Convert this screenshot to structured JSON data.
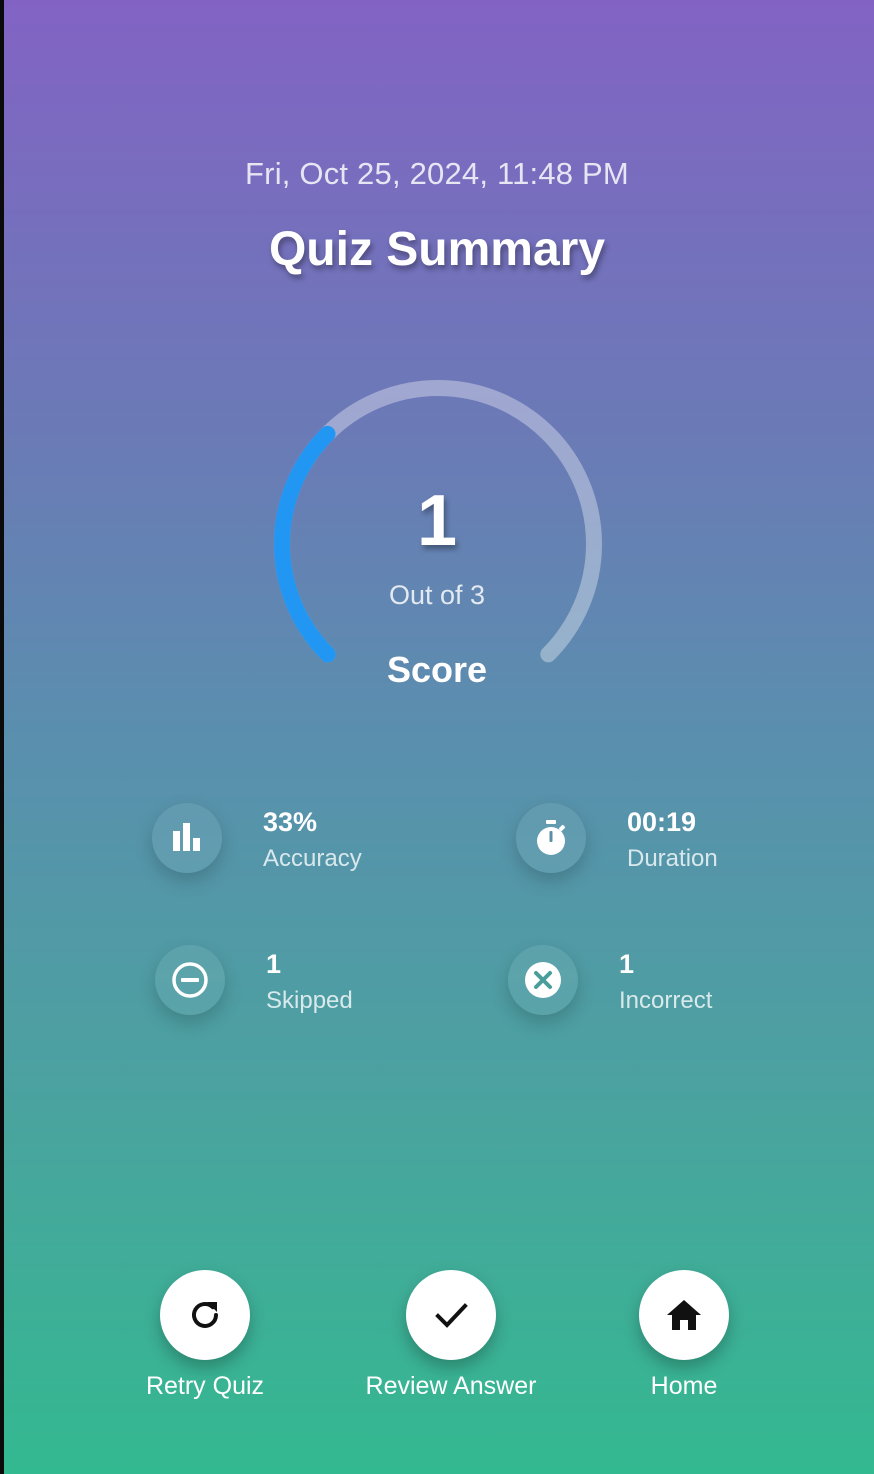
{
  "header": {
    "datetime": "Fri, Oct 25, 2024, 11:48 PM",
    "title": "Quiz Summary"
  },
  "score": {
    "value": "1",
    "out_of_label": "Out of 3",
    "label": "Score",
    "correct": 1,
    "total": 3,
    "progress_fraction": 0.333,
    "progress_color": "#2196f3",
    "track_color": "rgba(255,255,255,0.35)"
  },
  "stats": [
    {
      "name": "accuracy",
      "value": "33%",
      "label": "Accuracy",
      "icon": "bar-chart-icon"
    },
    {
      "name": "duration",
      "value": "00:19",
      "label": "Duration",
      "icon": "stopwatch-icon"
    },
    {
      "name": "skipped",
      "value": "1",
      "label": "Skipped",
      "icon": "minus-circle-icon"
    },
    {
      "name": "incorrect",
      "value": "1",
      "label": "Incorrect",
      "icon": "x-circle-icon"
    }
  ],
  "actions": [
    {
      "name": "retry",
      "label": "Retry Quiz",
      "icon": "refresh-icon"
    },
    {
      "name": "review",
      "label": "Review Answer",
      "icon": "check-icon"
    },
    {
      "name": "home",
      "label": "Home",
      "icon": "home-icon"
    }
  ],
  "colors": {
    "gradient_top": "#8263c4",
    "gradient_bottom": "#33b990",
    "accent": "#2196f3"
  }
}
